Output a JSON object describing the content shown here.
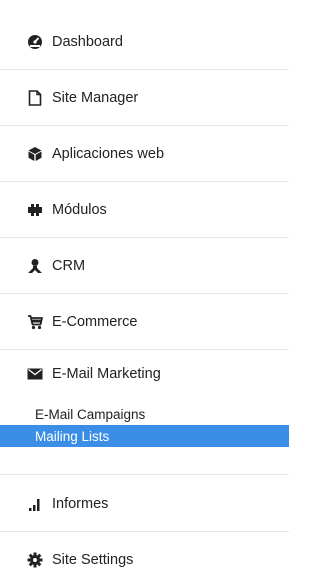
{
  "sidebar": {
    "items": [
      {
        "label": "Dashboard",
        "icon": "dashboard-icon"
      },
      {
        "label": "Site Manager",
        "icon": "file-icon"
      },
      {
        "label": "Aplicaciones web",
        "icon": "cube-icon"
      },
      {
        "label": "Módulos",
        "icon": "puzzle-icon"
      },
      {
        "label": "CRM",
        "icon": "user-icon"
      },
      {
        "label": "E-Commerce",
        "icon": "cart-icon"
      },
      {
        "label": "E-Mail Marketing",
        "icon": "envelope-icon"
      },
      {
        "label": "Informes",
        "icon": "bar-chart-icon"
      },
      {
        "label": "Site Settings",
        "icon": "gear-icon"
      }
    ],
    "submenu": [
      {
        "label": "E-Mail Campaigns",
        "active": false
      },
      {
        "label": "Mailing Lists",
        "active": true
      }
    ],
    "colors": {
      "active_bg": "#3a8ee6",
      "active_text": "#ffffff",
      "text": "#222222",
      "divider": "#e6e6e6"
    }
  }
}
